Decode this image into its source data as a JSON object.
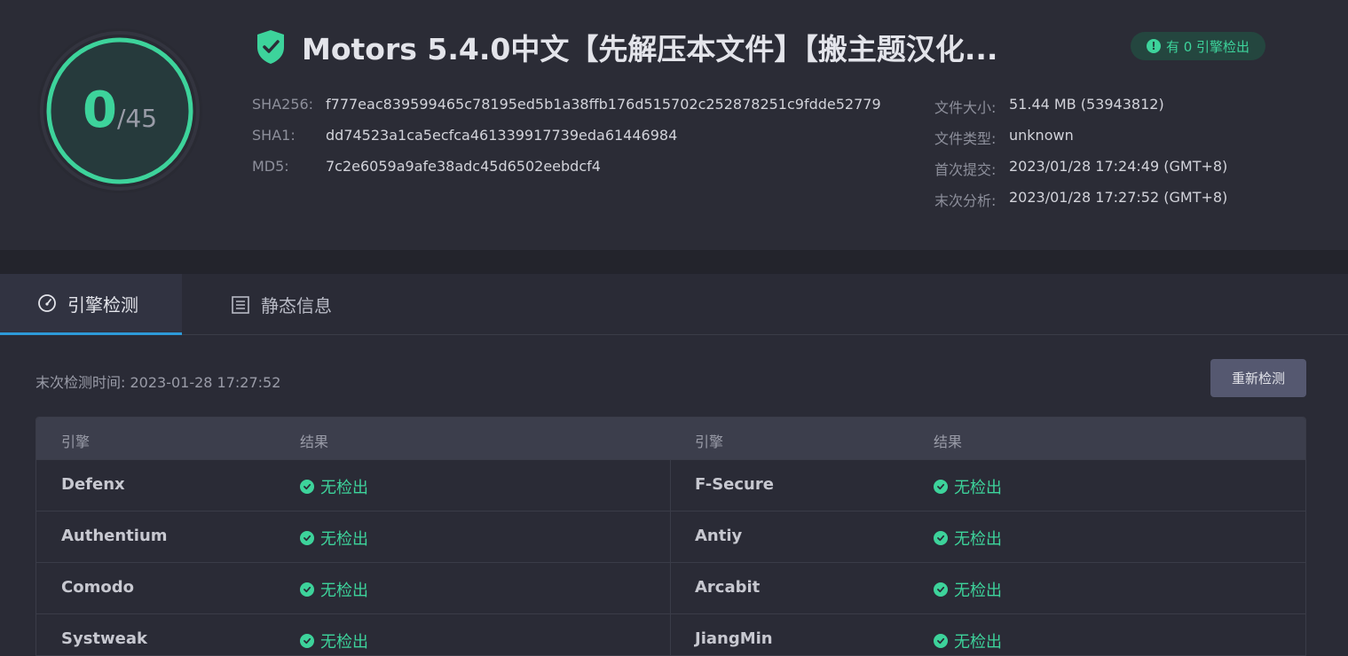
{
  "score": {
    "detected": "0",
    "total": "/45"
  },
  "title": "Motors 5.4.0中文【先解压本文件】【搬主题汉化...",
  "badge": {
    "icon": "alert-icon",
    "text": "有 0 引擎检出"
  },
  "hashes": [
    {
      "label": "SHA256:",
      "value": "f777eac839599465c78195ed5b1a38ffb176d515702c252878251c9fdde52779"
    },
    {
      "label": "SHA1:",
      "value": "dd74523a1ca5ecfca461339917739eda61446984"
    },
    {
      "label": "MD5:",
      "value": "7c2e6059a9afe38adc45d6502eebdcf4"
    }
  ],
  "meta": [
    {
      "label": "文件大小:",
      "value": "51.44 MB (53943812)"
    },
    {
      "label": "文件类型:",
      "value": "unknown"
    },
    {
      "label": "首次提交:",
      "value": "2023/01/28 17:24:49 (GMT+8)"
    },
    {
      "label": "末次分析:",
      "value": "2023/01/28 17:27:52 (GMT+8)"
    }
  ],
  "tabs": [
    {
      "label": "引擎检测",
      "icon": "gauge-icon",
      "active": true
    },
    {
      "label": "静态信息",
      "icon": "list-icon",
      "active": false
    }
  ],
  "last_scan": "末次检测时间: 2023-01-28 17:27:52",
  "rescan_button": "重新检测",
  "table": {
    "headers": [
      "引擎",
      "结果",
      "引擎",
      "结果"
    ],
    "rows": [
      {
        "left_engine": "Defenx",
        "left_result": "无检出",
        "right_engine": "F-Secure",
        "right_result": "无检出"
      },
      {
        "left_engine": "Authentium",
        "left_result": "无检出",
        "right_engine": "Antiy",
        "right_result": "无检出"
      },
      {
        "left_engine": "Comodo",
        "left_result": "无检出",
        "right_engine": "Arcabit",
        "right_result": "无检出"
      },
      {
        "left_engine": "Systweak",
        "left_result": "无检出",
        "right_engine": "JiangMin",
        "right_result": "无检出"
      }
    ]
  },
  "colors": {
    "accent": "#3dd39b",
    "tab_underline": "#2d9ad8",
    "background": "#2a2b36"
  }
}
